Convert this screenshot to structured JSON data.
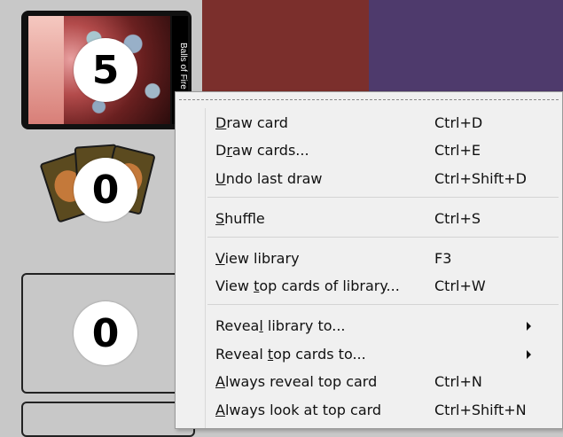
{
  "library": {
    "card_name": "Balls of Fire",
    "count": "5"
  },
  "graveyard": {
    "count": "0"
  },
  "exile": {
    "count": "0"
  },
  "menu": {
    "items": [
      {
        "label": "Draw card",
        "mnemonic": "D",
        "shortcut": "Ctrl+D"
      },
      {
        "label": "Draw cards...",
        "mnemonic": "r",
        "shortcut": "Ctrl+E"
      },
      {
        "label": "Undo last draw",
        "mnemonic": "U",
        "shortcut": "Ctrl+Shift+D"
      },
      {
        "label": "Shuffle",
        "mnemonic": "S",
        "shortcut": "Ctrl+S"
      },
      {
        "label": "View library",
        "mnemonic": "V",
        "shortcut": "F3"
      },
      {
        "label": "View top cards of library...",
        "mnemonic": "t",
        "shortcut": "Ctrl+W"
      },
      {
        "label": "Reveal library to...",
        "mnemonic": "l",
        "shortcut": ""
      },
      {
        "label": "Reveal top cards to...",
        "mnemonic": "t",
        "shortcut": ""
      },
      {
        "label": "Always reveal top card",
        "mnemonic": "A",
        "shortcut": "Ctrl+N"
      },
      {
        "label": "Always look at top card",
        "mnemonic": "A",
        "shortcut": "Ctrl+Shift+N"
      }
    ]
  },
  "colors": {
    "table_red": "#7b2f2c",
    "table_purple": "#4e3a6c",
    "panel_gray": "#c8c8c8",
    "menu_bg": "#f0f0f0"
  }
}
